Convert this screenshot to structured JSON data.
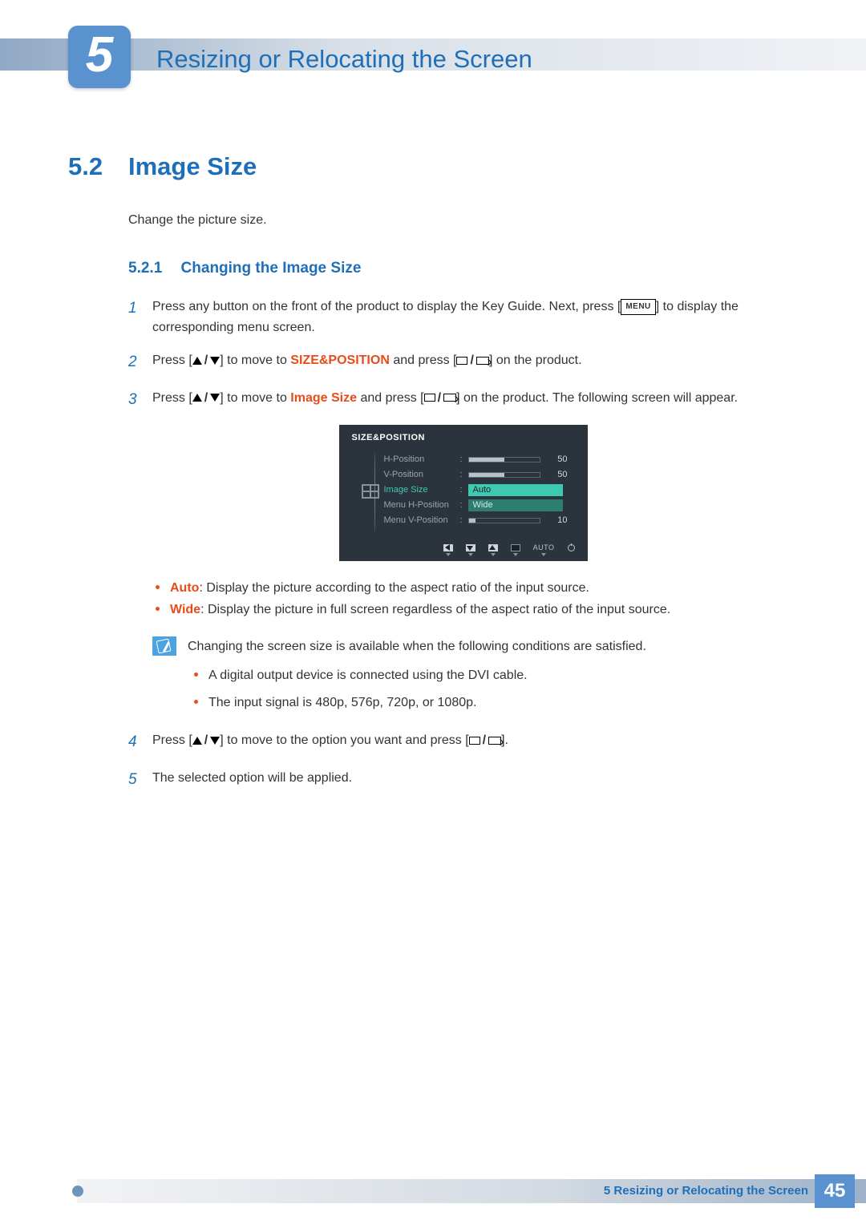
{
  "chapter": {
    "number": "5",
    "title": "Resizing or Relocating the Screen"
  },
  "section": {
    "number": "5.2",
    "title": "Image Size",
    "intro": "Change the picture size."
  },
  "subsection": {
    "number": "5.2.1",
    "title": "Changing the Image Size"
  },
  "steps": {
    "s1a": "Press any button on the front of the product to display the Key Guide. Next, press [",
    "s1b": "] to display the corresponding menu screen.",
    "menu_label": "MENU",
    "s2a": "Press [",
    "s2b": "] to move to ",
    "s2_hl": "SIZE&POSITION",
    "s2c": " and press [",
    "s2d": "] on the product.",
    "s3a": "Press [",
    "s3b": "] to move to ",
    "s3_hl": "Image Size",
    "s3c": " and press [",
    "s3d": "] on the product. The following screen will appear.",
    "s4a": "Press [",
    "s4b": "] to move to the option you want and press [",
    "s4c": "].",
    "s5": "The selected option will be applied."
  },
  "osd": {
    "title": "SIZE&POSITION",
    "rows": {
      "hpos": {
        "label": "H-Position",
        "value": "50",
        "fill": 50
      },
      "vpos": {
        "label": "V-Position",
        "value": "50",
        "fill": 50
      },
      "imgsize": {
        "label": "Image Size",
        "opt1": "Auto",
        "opt2": "Wide"
      },
      "mhpos": {
        "label": "Menu H-Position"
      },
      "mvpos": {
        "label": "Menu V-Position",
        "value": "10",
        "fill": 10
      }
    },
    "footer_auto": "AUTO"
  },
  "options": {
    "auto_label": "Auto",
    "auto_desc": ": Display the picture according to the aspect ratio of the input source.",
    "wide_label": "Wide",
    "wide_desc": ": Display the picture in full screen regardless of the aspect ratio of the input source."
  },
  "note": {
    "lead": "Changing the screen size is available when the following conditions are satisfied.",
    "b1": "A digital output device is connected using the DVI cable.",
    "b2": "The input signal is 480p, 576p, 720p, or 1080p."
  },
  "footer": {
    "text": "5 Resizing or Relocating the Screen",
    "page": "45"
  }
}
